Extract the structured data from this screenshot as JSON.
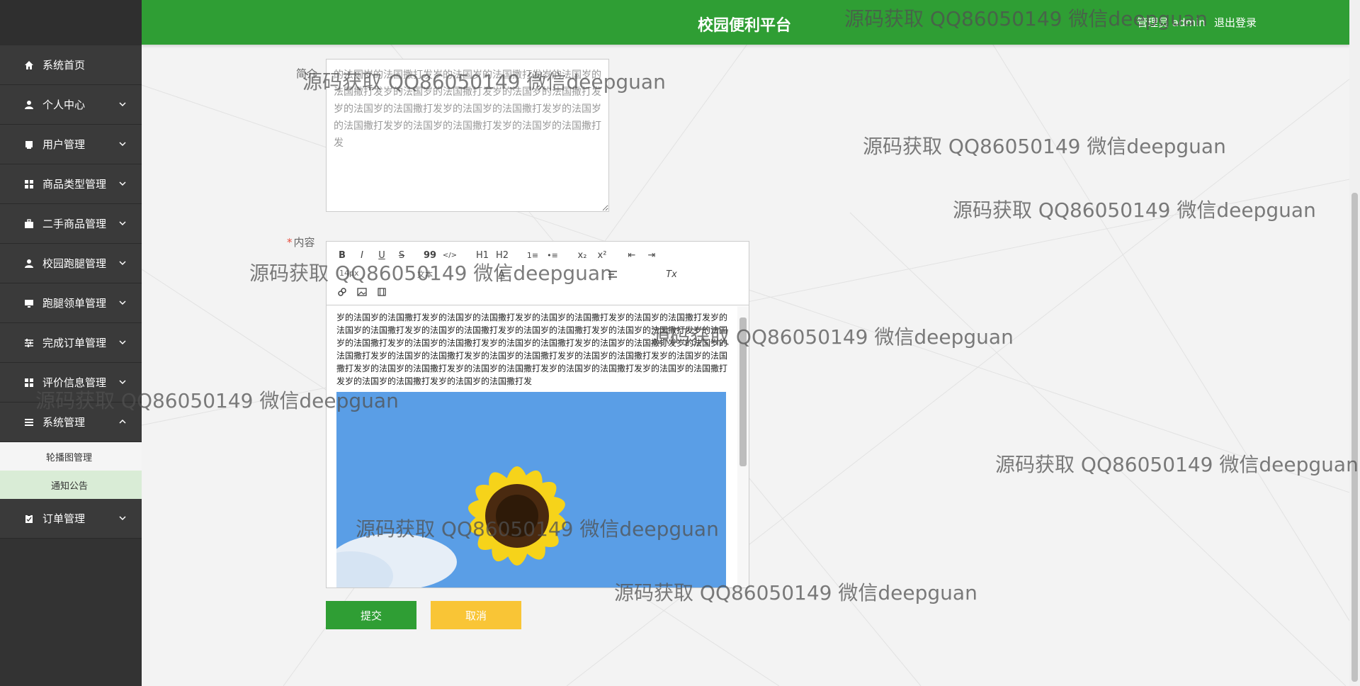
{
  "header": {
    "title": "校园便利平台",
    "user_label": "管理员 admin",
    "logout_label": "退出登录"
  },
  "sidebar": {
    "items": [
      {
        "label": "系统首页",
        "icon": "home-icon"
      },
      {
        "label": "个人中心",
        "icon": "person-icon"
      },
      {
        "label": "用户管理",
        "icon": "user-card-icon"
      },
      {
        "label": "商品类型管理",
        "icon": "grid-icon"
      },
      {
        "label": "二手商品管理",
        "icon": "briefcase-icon"
      },
      {
        "label": "校园跑腿管理",
        "icon": "person-icon"
      },
      {
        "label": "跑腿领单管理",
        "icon": "monitor-icon"
      },
      {
        "label": "完成订单管理",
        "icon": "sliders-icon"
      },
      {
        "label": "评价信息管理",
        "icon": "grid-icon"
      },
      {
        "label": "系统管理",
        "icon": "list-icon"
      },
      {
        "label": "订单管理",
        "icon": "clipboard-icon"
      }
    ],
    "submenu": [
      {
        "label": "轮播图管理"
      },
      {
        "label": "通知公告"
      }
    ]
  },
  "form": {
    "intro_label": "简介",
    "intro_text": "的法国岁的法国撒打发岁的法国岁的法国撒打发岁的法国岁的法国撒打发岁的法国岁的法国撒打发岁的法国岁的法国撒打发岁的法国岁的法国撒打发岁的法国岁的法国撒打发岁的法国岁的法国撒打发岁的法国岁的法国撒打发岁的法国岁的法国撒打发",
    "content_label": "内容",
    "required_mark": "*",
    "editor_text": "岁的法国岁的法国撒打发岁的法国岁的法国撒打发岁的法国岁的法国撒打发岁的法国岁的法国撒打发岁的法国岁的法国撒打发岁的法国岁的法国撒打发岁的法国岁的法国撒打发岁的法国岁的法国撒打发岁的法国岁的法国撒打发岁的法国岁的法国撒打发岁的法国岁的法国撒打发岁的法国岁的法国撒打发岁的法国岁的法国撒打发岁的法国岁的法国撒打发岁的法国岁的法国撒打发岁的法国岁的法国撒打发岁的法国岁的法国撒打发岁的法国岁的法国撒打发岁的法国岁的法国撒打发岁的法国岁的法国撒打发岁的法国岁的法国撒打发岁的法国岁的法国撒打发岁的法国岁的法国撒打发",
    "toolbar": {
      "bold": "B",
      "italic": "I",
      "underline": "U",
      "strike": "S",
      "quote": "99",
      "code": "</>",
      "h1": "H1",
      "h2": "H2",
      "ol": "1≡",
      "ul": "•≡",
      "sub": "x₂",
      "sup": "x²",
      "outdent": "⇤",
      "indent": "⇥",
      "size_select": "14px",
      "font_select": "文本",
      "color": "A",
      "clean": "Tx",
      "link": "🔗",
      "image": "▣",
      "video": "▦"
    },
    "submit_label": "提交",
    "cancel_label": "取消"
  },
  "watermark": {
    "text": "源码获取 QQ86050149 微信deepguan"
  }
}
